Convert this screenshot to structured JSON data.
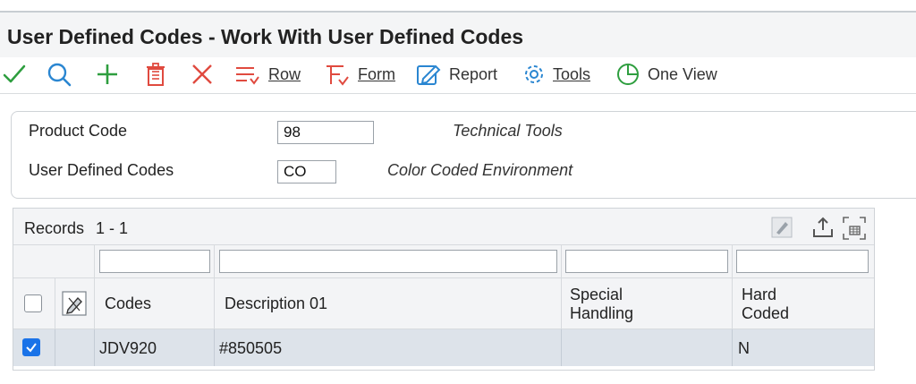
{
  "window": {
    "title": "User Defined Codes - Work With User Defined Codes"
  },
  "toolbar": {
    "row_label": "Row",
    "form_label": "Form",
    "report_label": "Report",
    "tools_label": "Tools",
    "oneview_label": "One View"
  },
  "header": {
    "product_code_label": "Product Code",
    "product_code_value": "98",
    "product_code_desc": "Technical Tools",
    "udc_label": "User Defined Codes",
    "udc_value": "CO",
    "udc_desc": "Color Coded Environment"
  },
  "grid": {
    "records_label": "Records",
    "records_range": "1 - 1",
    "columns": {
      "codes": "Codes",
      "description": "Description 01",
      "special_handling_1": "Special",
      "special_handling_2": "Handling",
      "hard_coded_1": "Hard",
      "hard_coded_2": "Coded"
    },
    "rows": [
      {
        "codes": "JDV920",
        "description": "#850505",
        "special_handling": "",
        "hard_coded": "N",
        "selected": true
      }
    ]
  },
  "colors": {
    "accent": "#1a73e8",
    "ok_green": "#2e9e3f",
    "delete_red": "#e04a3f",
    "find_blue": "#2a86d1"
  }
}
